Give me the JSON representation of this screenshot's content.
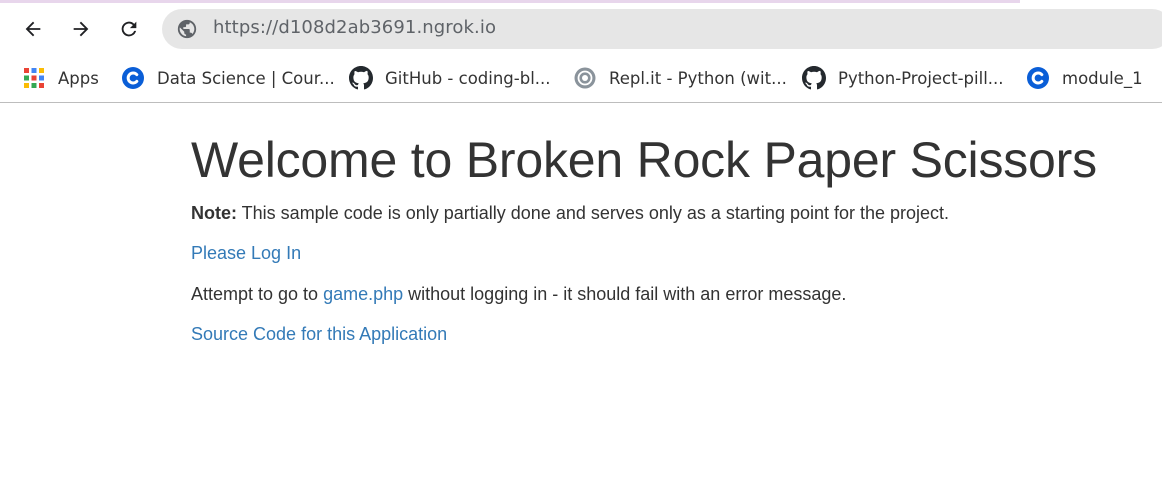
{
  "browser": {
    "url": "https://d108d2ab3691.ngrok.io",
    "nav": {
      "back": "back-arrow",
      "forward": "forward-arrow",
      "reload": "reload"
    },
    "bookmarks": [
      {
        "label": "Apps",
        "icon": "apps-grid-icon"
      },
      {
        "label": "Data Science | Cour...",
        "icon": "c-logo-icon"
      },
      {
        "label": "GitHub - coding-bl...",
        "icon": "github-icon"
      },
      {
        "label": "Repl.it - Python (wit...",
        "icon": "replit-icon"
      },
      {
        "label": "Python-Project-pill...",
        "icon": "github-icon"
      },
      {
        "label": "module_1",
        "icon": "c-logo-icon"
      }
    ]
  },
  "page": {
    "title": "Welcome to Broken Rock Paper Scissors",
    "note_label": "Note:",
    "note_text": " This sample code is only partially done and serves only as a starting point for the project.",
    "login_link": "Please Log In",
    "attempt_prefix": "Attempt to go to ",
    "attempt_link": "game.php",
    "attempt_suffix": " without logging in - it should fail with an error message.",
    "source_link": "Source Code for this Application"
  },
  "colors": {
    "link": "#337ab7",
    "text": "#333333",
    "omnibox": "#e6e6e6"
  }
}
